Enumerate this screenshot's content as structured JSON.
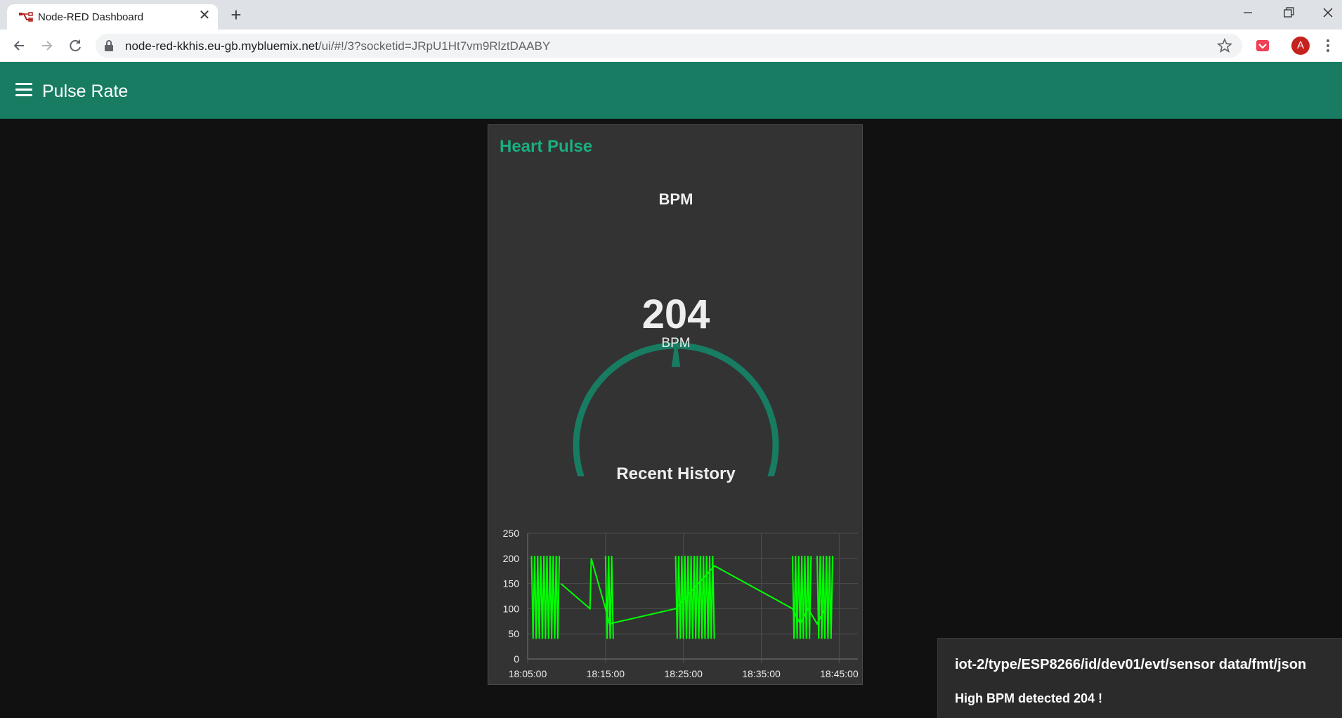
{
  "browser": {
    "tab_title": "Node-RED Dashboard",
    "url_host": "node-red-kkhis.eu-gb.mybluemix.net",
    "url_path": "/ui/#!/3?socketid=JRpU1Ht7vm9RlztDAABY",
    "avatar_letter": "A",
    "icons": [
      "node-red-favicon",
      "close-tab-icon",
      "new-tab-icon",
      "minimize-icon",
      "restore-icon",
      "close-window-icon",
      "back-icon",
      "forward-icon",
      "reload-icon",
      "lock-icon",
      "star-icon",
      "pocket-extension-icon",
      "kebab-menu-icon"
    ]
  },
  "dashboard": {
    "page_title": "Pulse Rate",
    "accent_color": "#177c62",
    "group_title": "Heart Pulse",
    "gauge": {
      "label": "BPM",
      "value": "204",
      "units": "BPM",
      "value_fraction": 1.0,
      "color": "#177c62"
    },
    "chart_title": "Recent History"
  },
  "chart_data": {
    "type": "line",
    "title": "Recent History",
    "xlabel": "",
    "ylabel": "",
    "x_ticks": [
      "18:05:00",
      "18:15:00",
      "18:25:00",
      "18:35:00",
      "18:45:00"
    ],
    "y_ticks": [
      "250",
      "200",
      "150",
      "100",
      "50",
      "0"
    ],
    "xlim": [
      "18:05:00",
      "18:46:30"
    ],
    "ylim": [
      0,
      250
    ],
    "grid": true,
    "series": [
      {
        "color": "#00ff00",
        "bursts": [
          {
            "start": "18:05:30",
            "end": "18:09:15",
            "low": 40,
            "high": 205
          },
          {
            "start": "18:15:00",
            "end": "18:16:00",
            "low": 40,
            "high": 205
          },
          {
            "start": "18:24:00",
            "end": "18:29:00",
            "low": 40,
            "high": 205
          },
          {
            "start": "18:39:00",
            "end": "18:41:30",
            "low": 40,
            "high": 205
          },
          {
            "start": "18:42:10",
            "end": "18:44:10",
            "low": 40,
            "high": 205
          }
        ],
        "points": [
          [
            "18:09:15",
            150
          ],
          [
            "18:13:00",
            100
          ],
          [
            "18:13:10",
            200
          ],
          [
            "18:15:00",
            100
          ],
          [
            "18:15:30",
            70
          ],
          [
            "18:24:00",
            100
          ],
          [
            "18:29:00",
            185
          ],
          [
            "18:39:00",
            100
          ],
          [
            "18:40:00",
            70
          ],
          [
            "18:41:00",
            100
          ],
          [
            "18:42:10",
            70
          ],
          [
            "18:43:10",
            100
          ]
        ]
      }
    ]
  },
  "toast": {
    "topic": "iot-2/type/ESP8266/id/dev01/evt/sensor data/fmt/json",
    "message": "High BPM detected 204 !"
  }
}
